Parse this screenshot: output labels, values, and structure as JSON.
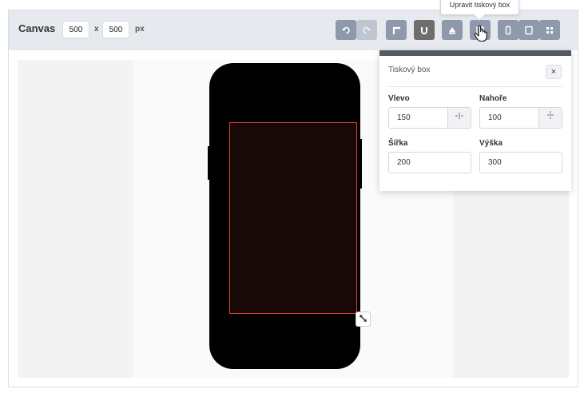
{
  "toolbar": {
    "title": "Canvas",
    "width_value": "500",
    "times_label": "x",
    "height_value": "500",
    "unit_label": "px",
    "buttons": [
      {
        "icon": "undo-icon"
      },
      {
        "icon": "redo-icon"
      },
      {
        "icon": "corner-icon"
      },
      {
        "icon": "magnet-icon"
      },
      {
        "icon": "layers-icon"
      },
      {
        "icon": "edit-print-box-icon"
      },
      {
        "icon": "phone-portrait-icon"
      },
      {
        "icon": "tablet-icon"
      },
      {
        "icon": "grid-icon"
      }
    ]
  },
  "tooltip": {
    "text": "Upravit tiskový box"
  },
  "panel": {
    "title": "Tiskový box",
    "close_label": "×",
    "left_label": "Vlevo",
    "left_value": "150",
    "top_label": "Nahoře",
    "top_value": "100",
    "width_label": "Šířka",
    "width_value": "200",
    "height_label": "Výška",
    "height_value": "300"
  },
  "colors": {
    "toolbar_bg": "#e6e9ee",
    "button_gray": "#8e9aab",
    "button_dark": "#6e6e6e",
    "print_box_border": "#e0402e",
    "panel_header": "#555b63"
  }
}
